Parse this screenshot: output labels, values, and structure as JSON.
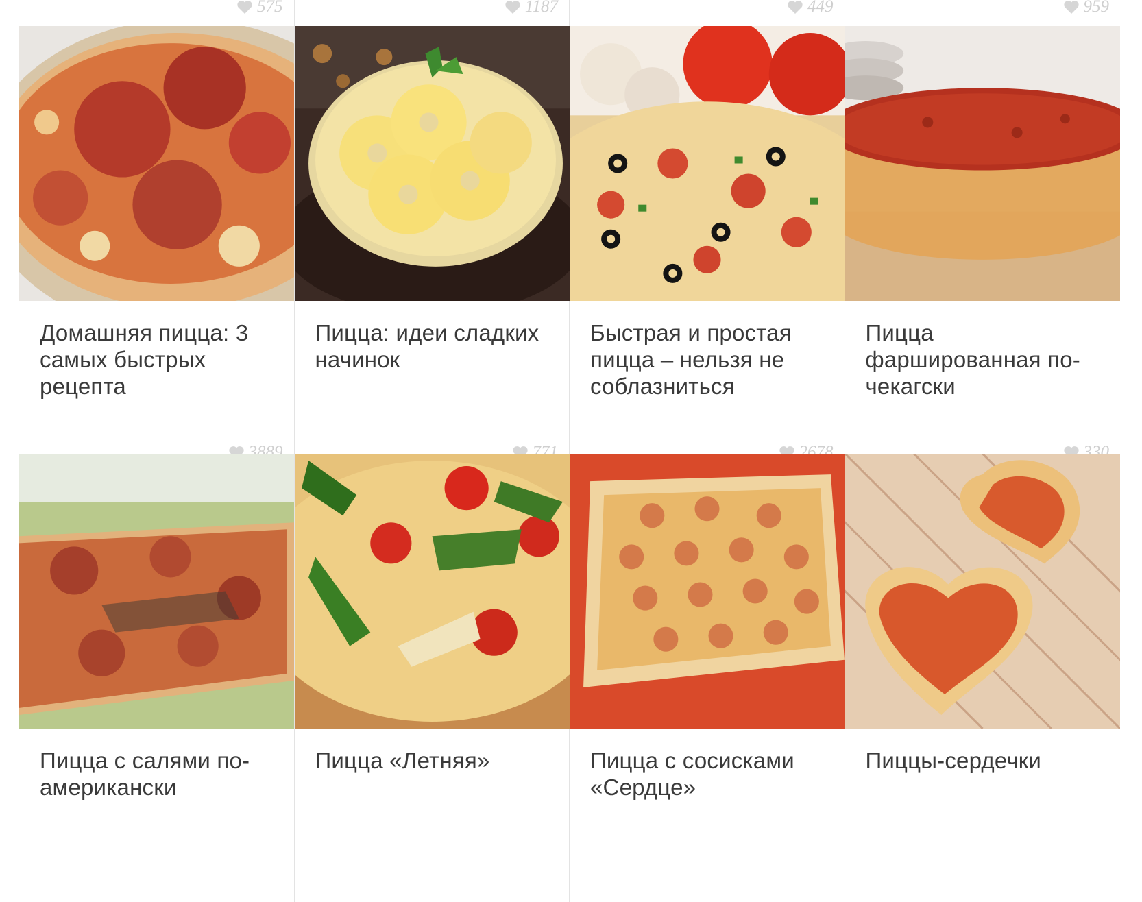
{
  "top_likes": [
    "575",
    "1187",
    "449",
    "959"
  ],
  "cards": [
    {
      "title": "Домашняя пицца: 3 самых быстрых рецепта",
      "likes": "3889",
      "image": "pepperoni-pizza-photo"
    },
    {
      "title": "Пицца: идеи сладких начинок",
      "likes": "771",
      "image": "pineapple-pizza-photo"
    },
    {
      "title": "Быстрая и простая пицца – нельзя не соблазниться",
      "likes": "2678",
      "image": "olive-pizza-photo"
    },
    {
      "title": "Пицца фаршированная по-чекагски",
      "likes": "330",
      "image": "deep-dish-pizza-photo"
    },
    {
      "title": "Пицца с салями по-американски",
      "likes": "",
      "image": "salami-pizza-photo"
    },
    {
      "title": "Пицца «Летняя»",
      "likes": "",
      "image": "summer-pizza-photo"
    },
    {
      "title": "Пицца с сосисками «Сердце»",
      "likes": "",
      "image": "sausage-pizza-photo"
    },
    {
      "title": "Пиццы-сердечки",
      "likes": "",
      "image": "heart-pizza-photo"
    }
  ],
  "colors": {
    "title_text": "#3a3a3a",
    "likes_text": "#cfcfcf",
    "divider": "#e3e3e3"
  }
}
